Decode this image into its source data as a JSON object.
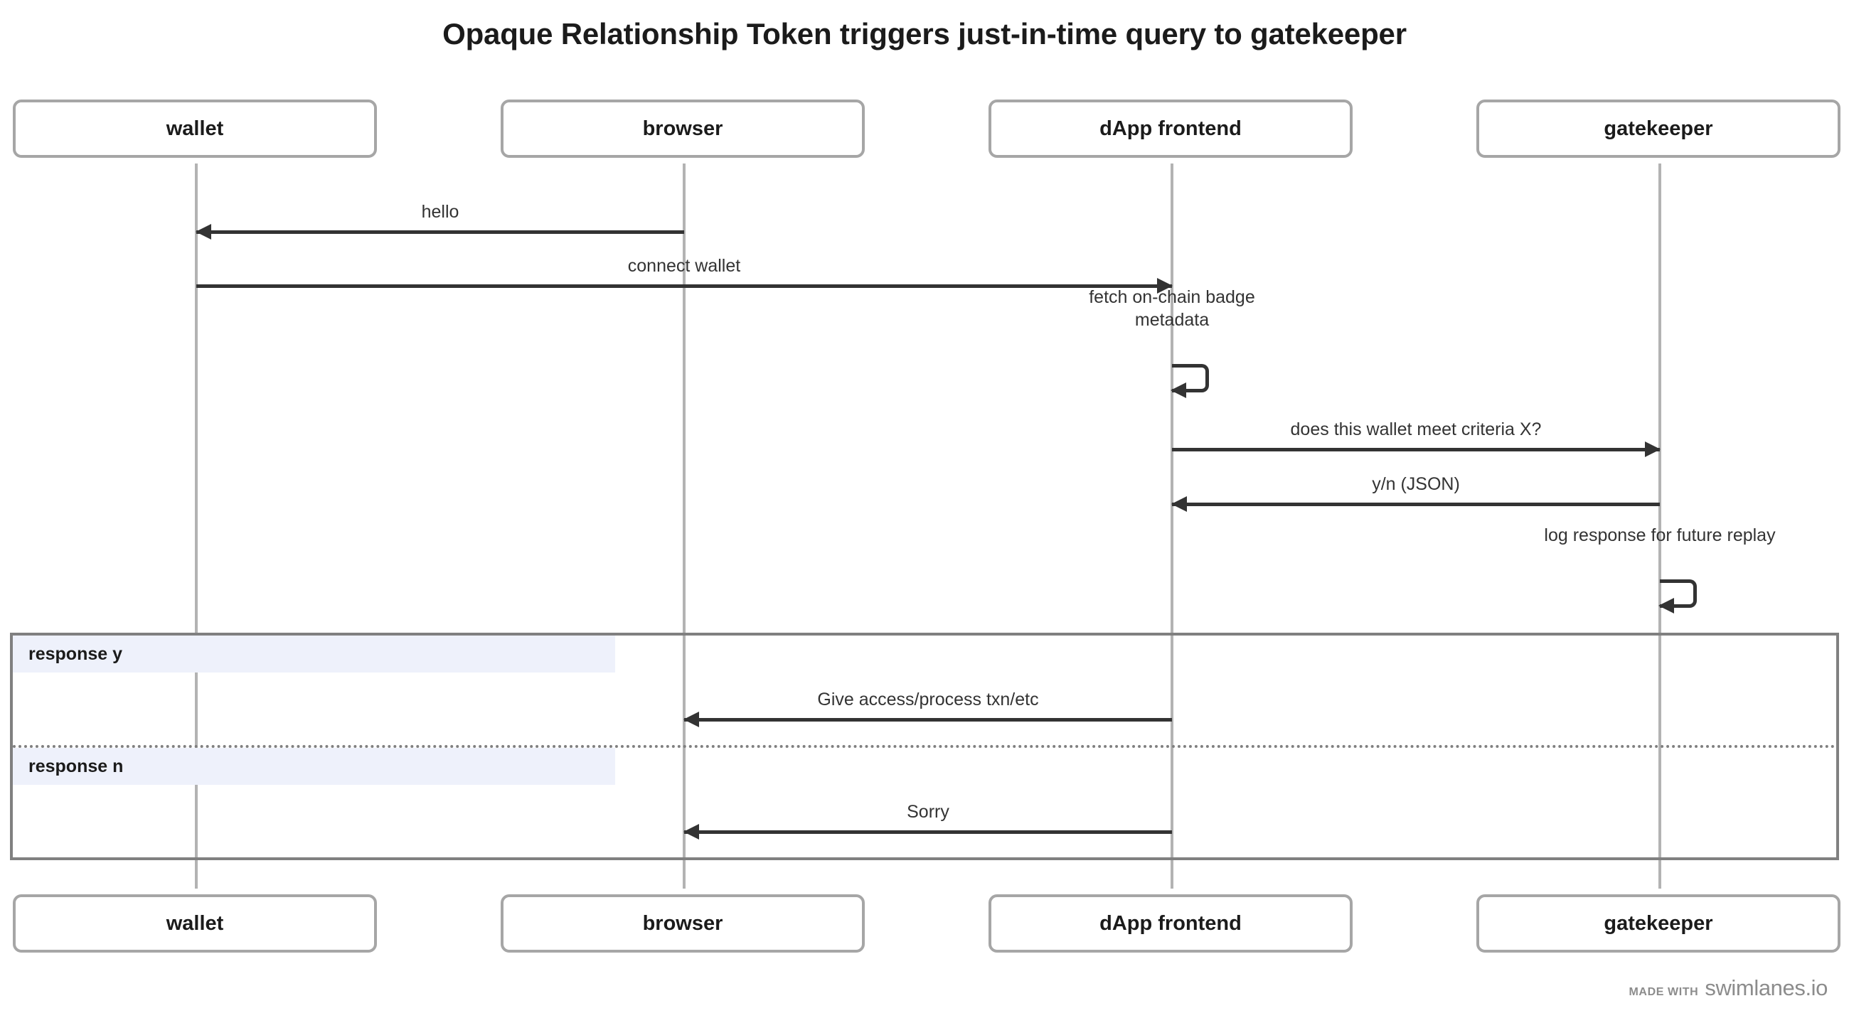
{
  "title": "Opaque Relationship Token triggers just-in-time query to gatekeeper",
  "participants": [
    {
      "id": "wallet",
      "label": "wallet"
    },
    {
      "id": "browser",
      "label": "browser"
    },
    {
      "id": "dapp",
      "label": "dApp frontend"
    },
    {
      "id": "gatekeeper",
      "label": "gatekeeper"
    }
  ],
  "messages": [
    {
      "id": "hello",
      "label": "hello",
      "from": "browser",
      "to": "wallet",
      "direction": "left"
    },
    {
      "id": "connect-wallet",
      "label": "connect wallet",
      "from": "wallet",
      "to": "dapp",
      "direction": "right"
    },
    {
      "id": "fetch-badge-metadata",
      "label": "fetch on-chain badge metadata",
      "from": "dapp",
      "to": "dapp",
      "direction": "self"
    },
    {
      "id": "criteria-query",
      "label": "does this wallet meet criteria X?",
      "from": "dapp",
      "to": "gatekeeper",
      "direction": "right"
    },
    {
      "id": "criteria-response",
      "label": "y/n (JSON)",
      "from": "gatekeeper",
      "to": "dapp",
      "direction": "left"
    },
    {
      "id": "log-response",
      "label": "log response for future replay",
      "from": "gatekeeper",
      "to": "gatekeeper",
      "direction": "self"
    },
    {
      "id": "give-access",
      "label": "Give access/process txn/etc",
      "from": "dapp",
      "to": "browser",
      "direction": "left"
    },
    {
      "id": "sorry",
      "label": "Sorry",
      "from": "dapp",
      "to": "browser",
      "direction": "left"
    }
  ],
  "fragment": {
    "sections": [
      {
        "id": "response-y",
        "label": "response y"
      },
      {
        "id": "response-n",
        "label": "response n"
      }
    ]
  },
  "watermark": {
    "prefix": "MADE WITH",
    "brand": "swimlanes.io"
  },
  "colors": {
    "participant_border": "#a6a6a6",
    "lifeline": "#b3b3b3",
    "message": "#333333",
    "fragment_border": "#808080",
    "fragment_label_bg": "#eef1fb",
    "watermark": "#8c8c8c"
  }
}
